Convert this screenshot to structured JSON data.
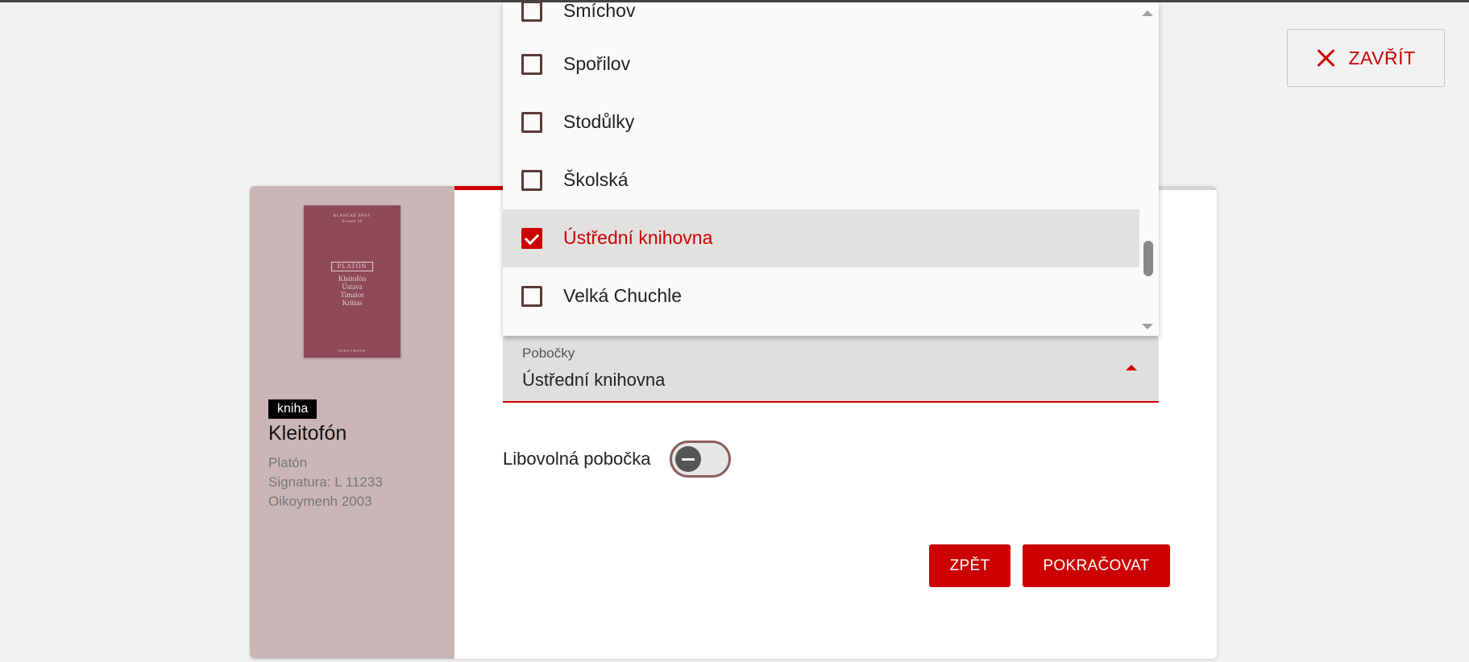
{
  "close_button": {
    "label": "ZAVŘÍT"
  },
  "book": {
    "cover": {
      "series": "KLASICKÉ SPISY",
      "series_vol": "Svazek 10",
      "author": "PLATÓN",
      "titles": [
        "Kleitofón",
        "Ústava",
        "Timaios",
        "Kritias"
      ],
      "publisher": "OIKOYMENH"
    },
    "type_badge": "kniha",
    "title": "Kleitofón",
    "author": "Platón",
    "signature": "Signatura: L 11233",
    "publisher": "Oikoymenh 2003"
  },
  "field": {
    "label": "Pobočky",
    "value": "Ústřední knihovna"
  },
  "dropdown": {
    "options": [
      {
        "label": "Smíchov",
        "checked": false
      },
      {
        "label": "Spořilov",
        "checked": false
      },
      {
        "label": "Stodůlky",
        "checked": false
      },
      {
        "label": "Školská",
        "checked": false
      },
      {
        "label": "Ústřední knihovna",
        "checked": true
      },
      {
        "label": "Velká Chuchle",
        "checked": false
      }
    ]
  },
  "toggle": {
    "label": "Libovolná pobočka",
    "on": false
  },
  "buttons": {
    "back": "ZPĚT",
    "next": "POKRAČOVAT"
  },
  "colors": {
    "accent": "#cc0000",
    "sidebar": "#cab5b8"
  }
}
